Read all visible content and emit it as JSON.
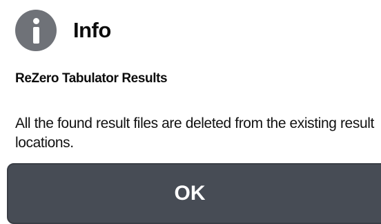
{
  "dialog": {
    "icon": "info-icon",
    "title": "Info",
    "subtitle": "ReZero Tabulator Results",
    "message": "All the found result files are deleted from the existing result locations.",
    "ok_label": "OK"
  },
  "colors": {
    "icon_background": "#6f7278",
    "button_background": "#474c55",
    "button_text": "#ffffff"
  }
}
